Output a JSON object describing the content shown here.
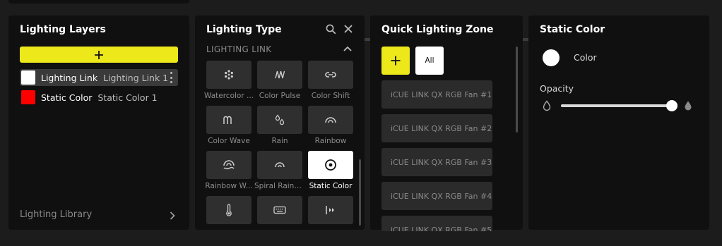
{
  "layers": {
    "title": "Lighting Layers",
    "add_icon": "plus-icon",
    "items": [
      {
        "name": "Lighting Link",
        "sub": "Lighting Link 1",
        "color": "#ffffff",
        "selected": true
      },
      {
        "name": "Static Color",
        "sub": "Static Color 1",
        "color": "#ff0000",
        "selected": false
      }
    ],
    "library_label": "Lighting Library"
  },
  "types": {
    "title": "Lighting Type",
    "section": "LIGHTING LINK",
    "tiles": [
      {
        "label": "Watercolor ...",
        "icon": "watercolor-icon"
      },
      {
        "label": "Color Pulse",
        "icon": "color-pulse-icon"
      },
      {
        "label": "Color Shift",
        "icon": "color-shift-icon"
      },
      {
        "label": "Color Wave",
        "icon": "color-wave-icon"
      },
      {
        "label": "Rain",
        "icon": "rain-icon"
      },
      {
        "label": "Rainbow",
        "icon": "rainbow-icon"
      },
      {
        "label": "Rainbow W...",
        "icon": "rainbow-wave-icon"
      },
      {
        "label": "Spiral Rainb...",
        "icon": "spiral-rainbow-icon"
      },
      {
        "label": "Static Color",
        "icon": "static-color-icon",
        "active": true
      },
      {
        "label": "",
        "icon": "temperature-icon"
      },
      {
        "label": "",
        "icon": "keyboard-icon"
      },
      {
        "label": "",
        "icon": "sequential-icon"
      }
    ]
  },
  "zone": {
    "title": "Quick Lighting Zone",
    "all_label": "All",
    "items": [
      "iCUE LINK QX RGB Fan #1",
      "iCUE LINK QX RGB Fan #2",
      "iCUE LINK QX RGB Fan #3",
      "iCUE LINK QX RGB Fan #4",
      "iCUE LINK QX RGB Fan #5"
    ]
  },
  "static": {
    "title": "Static Color",
    "color_label": "Color",
    "color_value": "#ffffff",
    "opacity_label": "Opacity",
    "opacity_value": 1.0
  },
  "accent": "#ece81a"
}
